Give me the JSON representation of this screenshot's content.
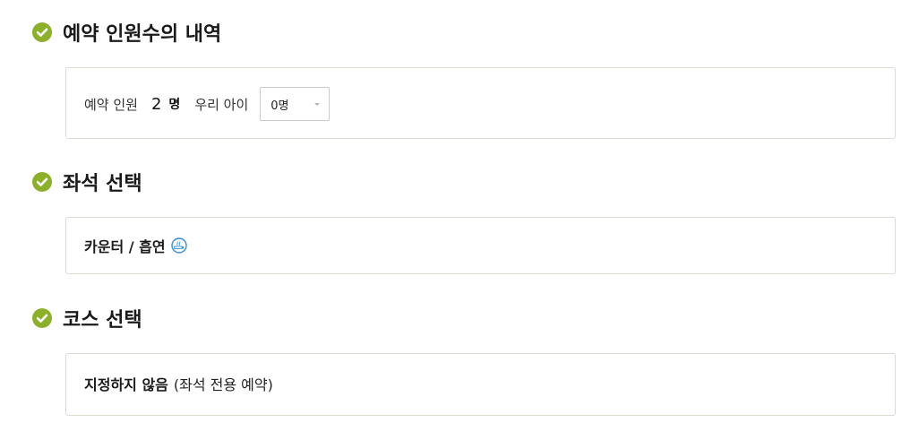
{
  "sections": {
    "party": {
      "title": "예약 인원수의 내역",
      "people_label": "예약 인원",
      "people_count": "2",
      "people_unit": "명",
      "children_label": "우리 아이",
      "children_select_value": "0명"
    },
    "seat": {
      "title": "좌석 선택",
      "value": "카운터 / 흡연",
      "icon": "smoking-icon"
    },
    "course": {
      "title": "코스 선택",
      "value": "지정하지 않음",
      "note": "(좌석 전용 예약)"
    }
  },
  "colors": {
    "check_green": "#8cb02a",
    "box_border": "#dcdcd2",
    "smoke_icon_blue": "#3a8fd6"
  }
}
